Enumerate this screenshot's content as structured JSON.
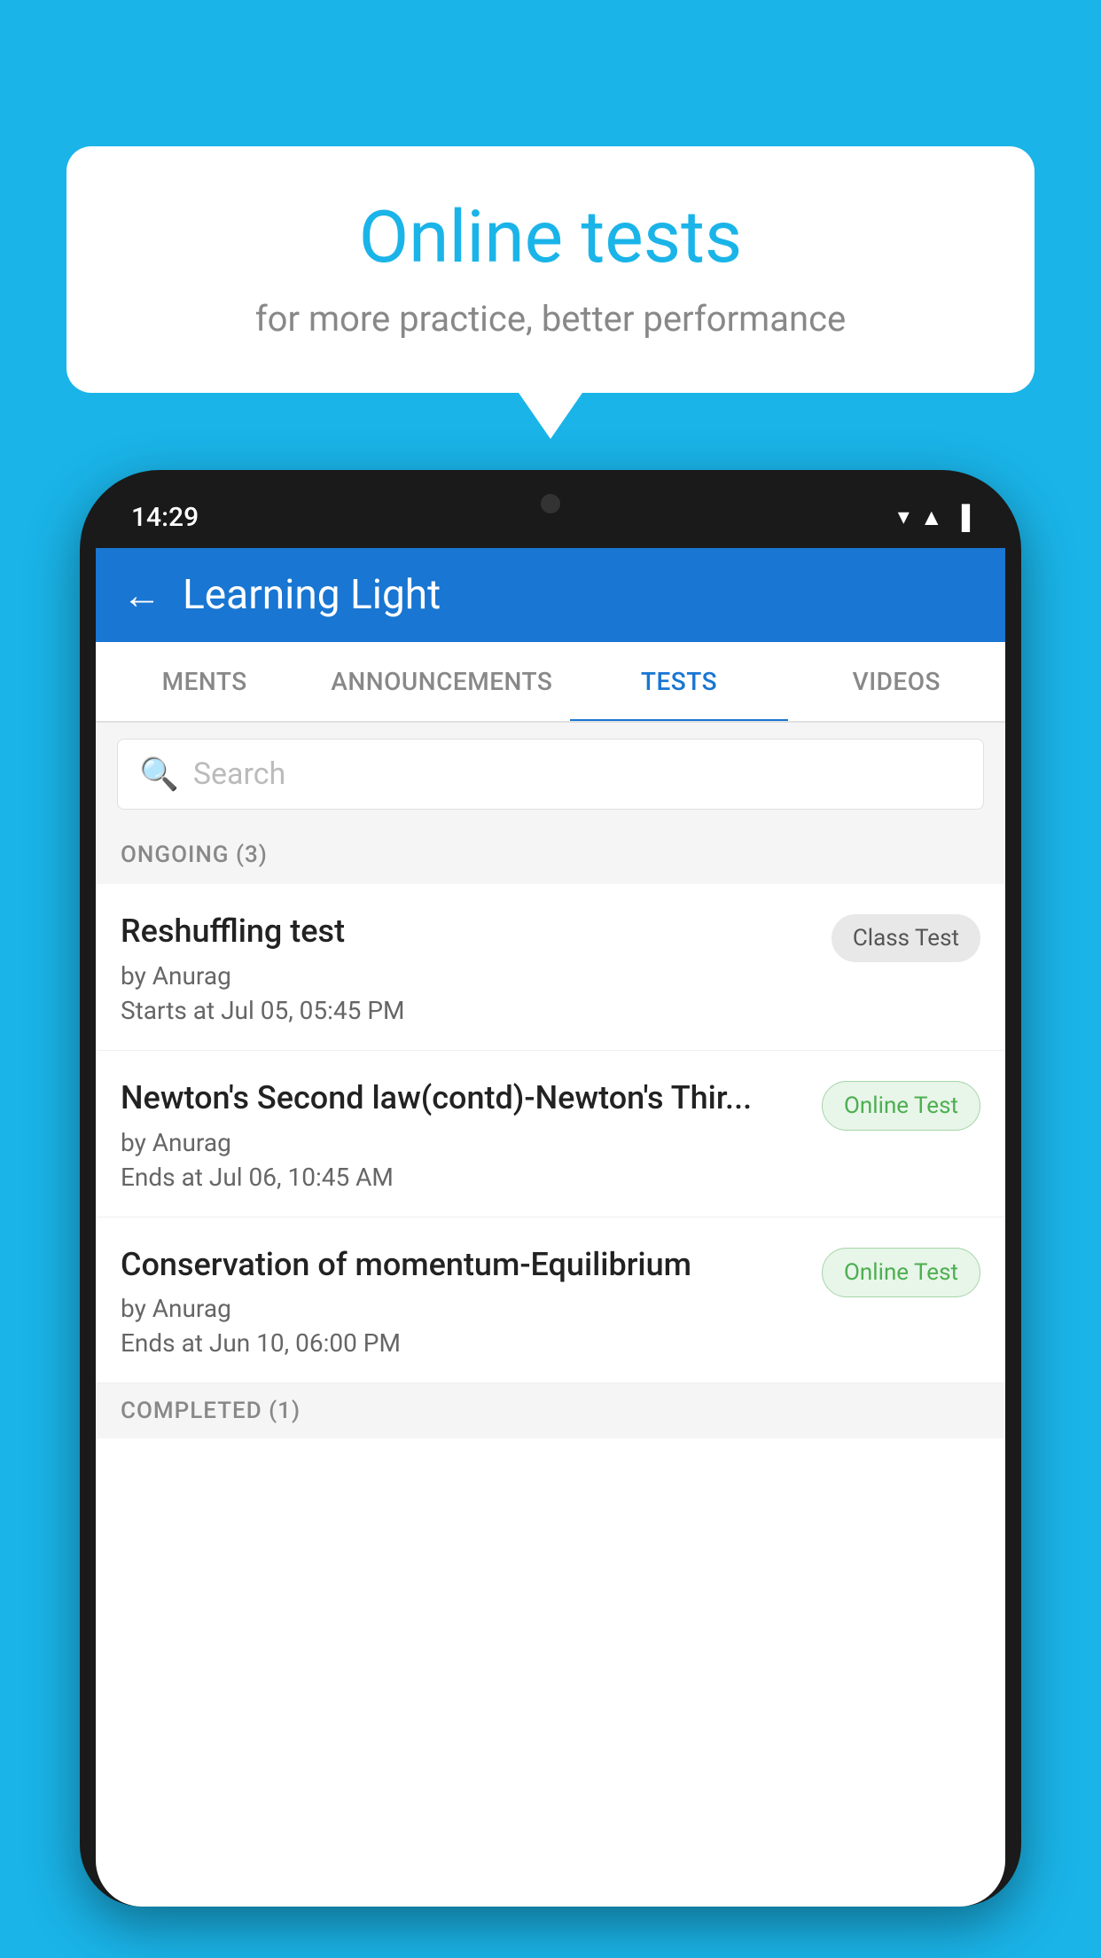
{
  "background": {
    "color": "#1ab4e8"
  },
  "speech_bubble": {
    "title": "Online tests",
    "subtitle": "for more practice, better performance"
  },
  "phone": {
    "status_bar": {
      "time": "14:29",
      "icons": [
        "▼",
        "▲",
        "▐"
      ]
    },
    "header": {
      "back_label": "←",
      "title": "Learning Light"
    },
    "tabs": [
      {
        "label": "MENTS",
        "active": false
      },
      {
        "label": "ANNOUNCEMENTS",
        "active": false
      },
      {
        "label": "TESTS",
        "active": true
      },
      {
        "label": "VIDEOS",
        "active": false
      }
    ],
    "search": {
      "placeholder": "Search",
      "icon": "🔍"
    },
    "sections": [
      {
        "label": "ONGOING (3)",
        "tests": [
          {
            "name": "Reshuffling test",
            "author": "by Anurag",
            "date": "Starts at  Jul 05, 05:45 PM",
            "badge": "Class Test",
            "badge_type": "class"
          },
          {
            "name": "Newton's Second law(contd)-Newton's Thir...",
            "author": "by Anurag",
            "date": "Ends at  Jul 06, 10:45 AM",
            "badge": "Online Test",
            "badge_type": "online"
          },
          {
            "name": "Conservation of momentum-Equilibrium",
            "author": "by Anurag",
            "date": "Ends at  Jun 10, 06:00 PM",
            "badge": "Online Test",
            "badge_type": "online"
          }
        ]
      },
      {
        "label": "COMPLETED (1)",
        "tests": []
      }
    ]
  }
}
